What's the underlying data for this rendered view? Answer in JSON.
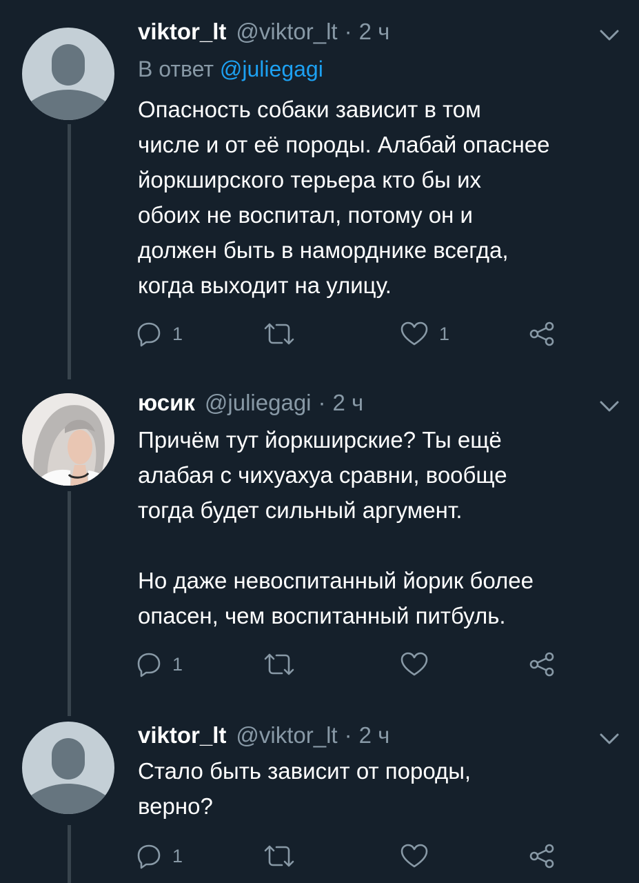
{
  "tweets": [
    {
      "name": "viktor_lt",
      "handle": "@viktor_lt",
      "separator": "·",
      "time": "2 ч",
      "reply_prefix": "В ответ",
      "reply_handle": "@juliegagi",
      "body": [
        "Опасность собаки зависит в том",
        "числе и от её породы. Алабай опаснее",
        "йоркширского терьера кто бы их",
        "обоих не воспитал, потому он и",
        "должен быть в наморднике всегда,",
        "когда выходит на улицу."
      ],
      "reply_count": "1",
      "like_count": "1",
      "avatar": "default-avatar"
    },
    {
      "name": "юсик",
      "handle": "@juliegagi",
      "separator": "·",
      "time": "2 ч",
      "body": [
        "Причём тут йоркширские? Ты ещё",
        "алабая с чихуахуа сравни, вообще",
        "тогда будет сильный аргумент.",
        "",
        "Но даже невоспитанный йорик более",
        "опасен, чем воспитанный питбуль."
      ],
      "reply_count": "1",
      "like_count": "",
      "avatar": "photo-avatar"
    },
    {
      "name": "viktor_lt",
      "handle": "@viktor_lt",
      "separator": "·",
      "time": "2 ч",
      "body": [
        "Стало быть зависит от породы,",
        "верно?"
      ],
      "reply_count": "1",
      "like_count": "",
      "avatar": "default-avatar"
    }
  ],
  "icons": [
    "reply-icon",
    "retweet-icon",
    "like-icon",
    "share-icon",
    "chevron-down-icon"
  ],
  "colors": {
    "background": "#15202b",
    "text": "#ffffff",
    "secondary": "#8899a6",
    "link": "#1da1f2",
    "thread_line": "#38444d"
  }
}
